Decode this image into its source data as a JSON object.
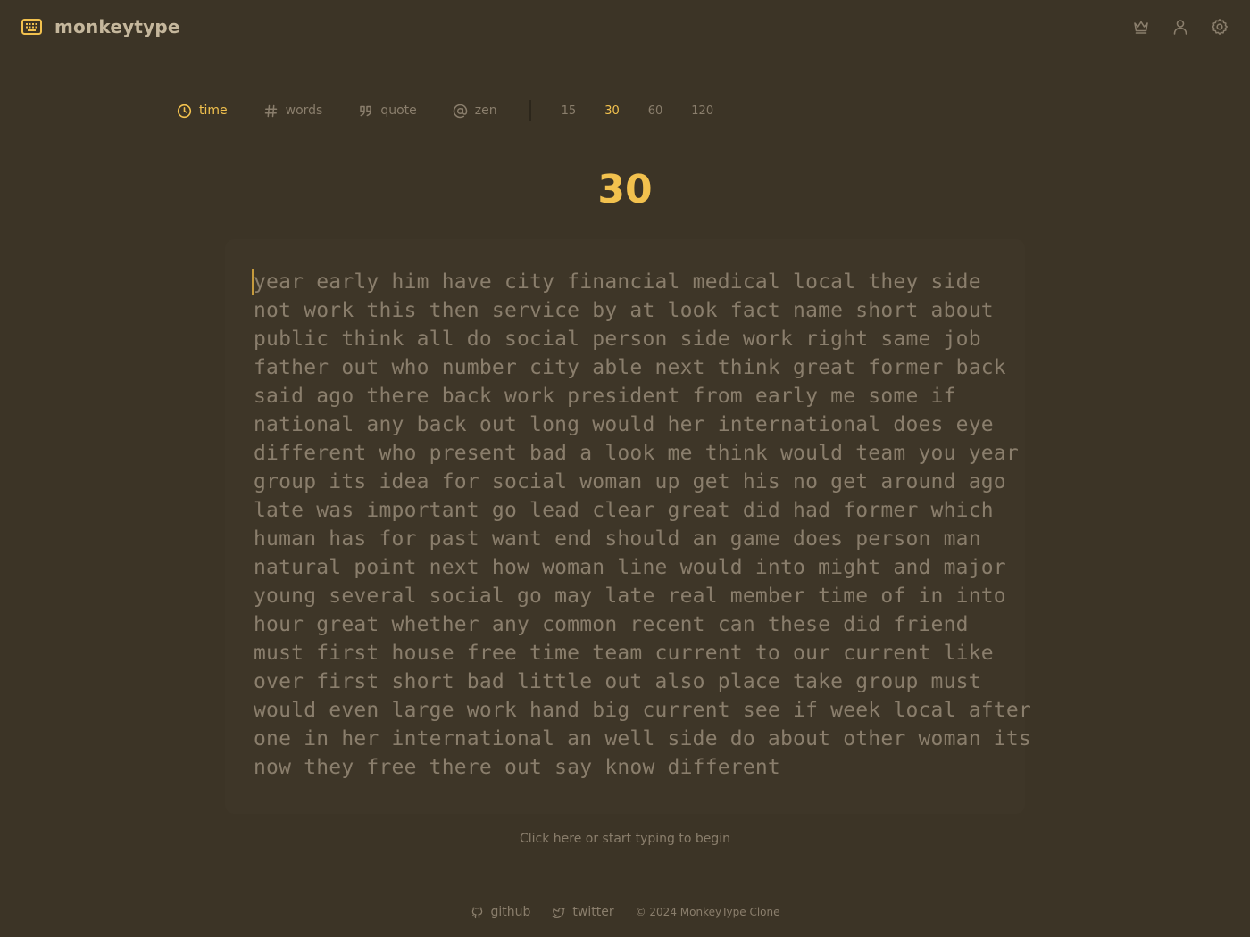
{
  "app": {
    "name": "monkeytype"
  },
  "modes": {
    "time": "time",
    "words": "words",
    "quote": "quote",
    "zen": "zen",
    "active": "time"
  },
  "durations": [
    "15",
    "30",
    "60",
    "120"
  ],
  "selected_duration": "30",
  "timer": "30",
  "words": [
    "year early him have city financial medical local they side",
    "not work this then service by at look fact name short about",
    "public think all do social person side work right same job",
    "father out who number city able next think great former back",
    "said ago there back work president from early me some if",
    "national any back out long would her international does eye",
    "different who present bad a look me think would team you year",
    "group its idea for social woman up get his no get around ago",
    "late was important go lead clear great did had former which",
    "human has for past want end should an game does person man",
    "natural point next how woman line would into might and major",
    "young several social go may late real member time of in into",
    "hour great whether any common recent can these did friend",
    "must first house free time team current to our current like",
    "over first short bad little out also place take group must",
    "would even large work hand big current see if week local after",
    "one in her international an well side do about other woman its",
    "now they free there out say know different"
  ],
  "hint": "Click here or start typing to begin",
  "footer": {
    "github": "github",
    "twitter": "twitter",
    "copyright": "© 2024 MonkeyType Clone"
  },
  "colors": {
    "background": "#3c3426",
    "accent": "#f2c14e",
    "text": "#8a7e6c",
    "logo_text": "#c5b79c"
  }
}
